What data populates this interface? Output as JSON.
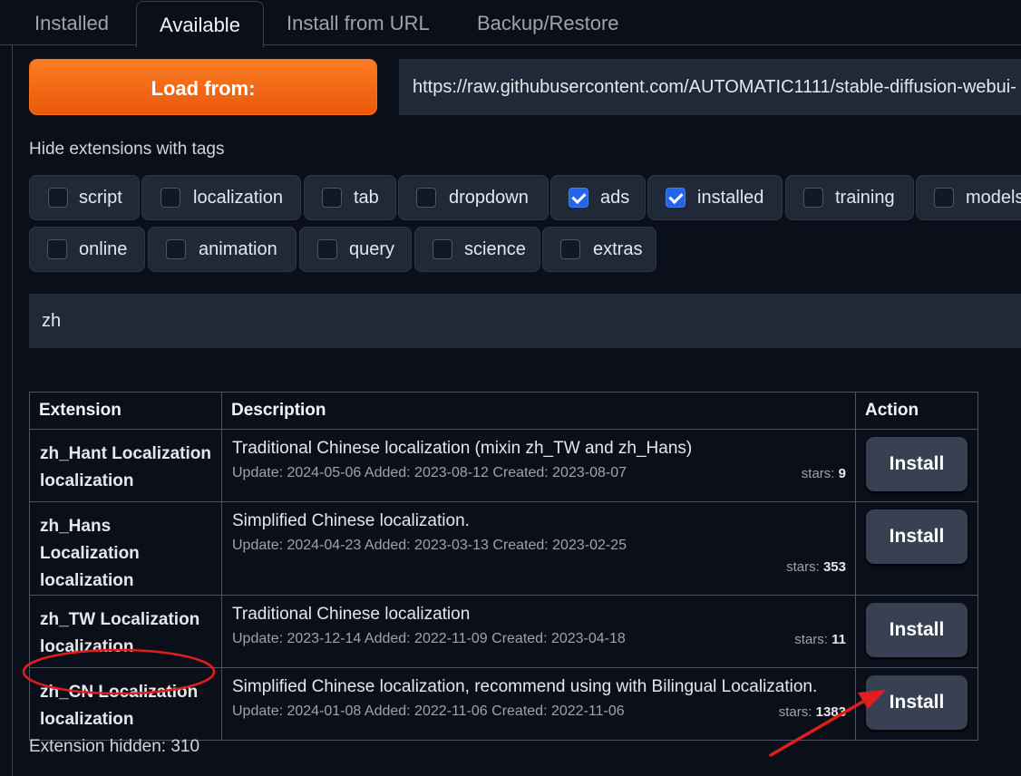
{
  "tabs": [
    "Installed",
    "Available",
    "Install from URL",
    "Backup/Restore"
  ],
  "load_button": "Load from:",
  "url_value": "https://raw.githubusercontent.com/AUTOMATIC1111/stable-diffusion-webui-",
  "hide_label": "Hide extensions with tags",
  "tags": [
    {
      "label": "script",
      "checked": false
    },
    {
      "label": "localization",
      "checked": false
    },
    {
      "label": "tab",
      "checked": false
    },
    {
      "label": "dropdown",
      "checked": false
    },
    {
      "label": "ads",
      "checked": true
    },
    {
      "label": "installed",
      "checked": true
    },
    {
      "label": "training",
      "checked": false
    },
    {
      "label": "models",
      "checked": false
    },
    {
      "label": "online",
      "checked": false
    },
    {
      "label": "animation",
      "checked": false
    },
    {
      "label": "query",
      "checked": false
    },
    {
      "label": "science",
      "checked": false
    },
    {
      "label": "extras",
      "checked": false
    }
  ],
  "search_value": "zh",
  "table": {
    "headers": [
      "Extension",
      "Description",
      "Action"
    ],
    "rows": [
      {
        "name": "zh_Hant Localization",
        "tag": "localization",
        "description": "Traditional Chinese localization (mixin zh_TW and zh_Hans)",
        "meta": "Update: 2024-05-06 Added: 2023-08-12 Created: 2023-08-07",
        "stars_label": "stars:",
        "stars": "9",
        "action": "Install"
      },
      {
        "name": "zh_Hans Localization",
        "tag": "localization",
        "description": "Simplified Chinese localization.",
        "meta": "Update: 2024-04-23 Added: 2023-03-13 Created: 2023-02-25",
        "stars_label": "stars:",
        "stars": "353",
        "action": "Install"
      },
      {
        "name": "zh_TW Localization",
        "tag": "localization",
        "description": "Traditional Chinese localization",
        "meta": "Update: 2023-12-14 Added: 2022-11-09 Created: 2023-04-18",
        "stars_label": "stars:",
        "stars": "11",
        "action": "Install"
      },
      {
        "name": "zh_CN Localization",
        "tag": "localization",
        "description": "Simplified Chinese localization, recommend using with Bilingual Localization.",
        "meta": "Update: 2024-01-08 Added: 2022-11-06 Created: 2022-11-06",
        "stars_label": "stars:",
        "stars": "1383",
        "action": "Install"
      }
    ]
  },
  "footer": "Extension hidden: 310",
  "colors": {
    "accent": "#f97316",
    "annotation": "#e11d1d",
    "checkbox_on": "#2563eb",
    "background": "#0b0f19"
  }
}
